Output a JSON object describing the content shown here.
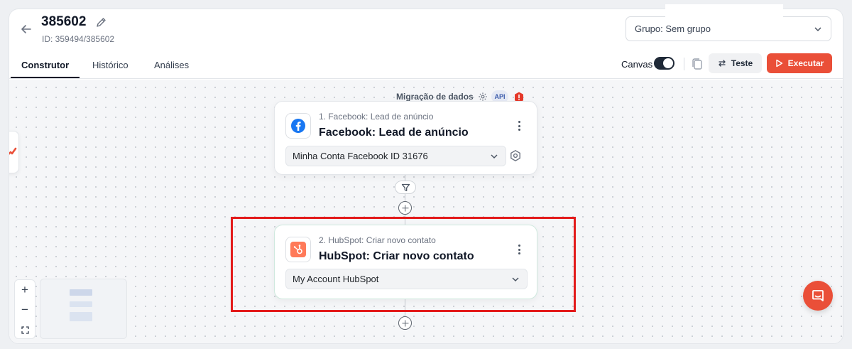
{
  "header": {
    "title": "385602",
    "flow_id": "ID: 359494/385602",
    "group_select": "Grupo: Sem grupo"
  },
  "tabs": [
    {
      "label": "Construtor",
      "active": true
    },
    {
      "label": "Histórico",
      "active": false
    },
    {
      "label": "Análises",
      "active": false
    }
  ],
  "toolbar": {
    "canvas_label": "Canvas",
    "canvas_toggle_on": true,
    "test_label": "Teste",
    "run_label": "Executar"
  },
  "canvas": {
    "group_label": "Migração de dados",
    "api_badge": "API",
    "nodes": [
      {
        "step": "1. Facebook: Lead de anúncio",
        "title": "Facebook: Lead de anúncio",
        "account": "Minha Conta Facebook ID 31676",
        "icon": "facebook-icon"
      },
      {
        "step": "2. HubSpot: Criar novo contato",
        "title": "HubSpot: Criar novo contato",
        "account": "My Account HubSpot",
        "icon": "hubspot-icon"
      }
    ]
  },
  "zoom": {
    "in": "+",
    "out": "−"
  },
  "colors": {
    "accent": "#ea4f38",
    "facebook": "#1877f2",
    "hubspot": "#ff7a59",
    "highlight": "#e31b1b"
  }
}
